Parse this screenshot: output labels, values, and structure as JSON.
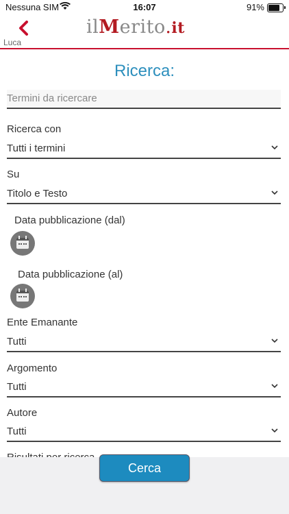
{
  "status_bar": {
    "carrier": "Nessuna SIM",
    "time": "16:07",
    "battery_percent": "91%",
    "battery_level": 0.91
  },
  "nav": {
    "back_label": "Luca",
    "logo_il": "il",
    "logo_m": "M",
    "logo_erito": "erito",
    "logo_dot": ".",
    "logo_it": "it"
  },
  "page": {
    "title": "Ricerca:"
  },
  "search": {
    "placeholder": "Termini da ricercare",
    "value": ""
  },
  "fields": {
    "ricerca_con": {
      "label": "Ricerca con",
      "value": "Tutti i termini"
    },
    "su": {
      "label": "Su",
      "value": "Titolo e Testo"
    },
    "data_dal": {
      "label": "Data pubblicazione (dal)"
    },
    "data_al": {
      "label": "Data pubblicazione (al)"
    },
    "ente": {
      "label": "Ente Emanante",
      "value": "Tutti"
    },
    "argomento": {
      "label": "Argomento",
      "value": "Tutti"
    },
    "autore": {
      "label": "Autore",
      "value": "Tutti"
    },
    "risultati": {
      "label": "Risultati per ricerca"
    }
  },
  "actions": {
    "cerca_label": "Cerca"
  },
  "colors": {
    "accent": "#2d8fbd",
    "brand_red": "#b31b22",
    "button": "#1d8bbf"
  }
}
